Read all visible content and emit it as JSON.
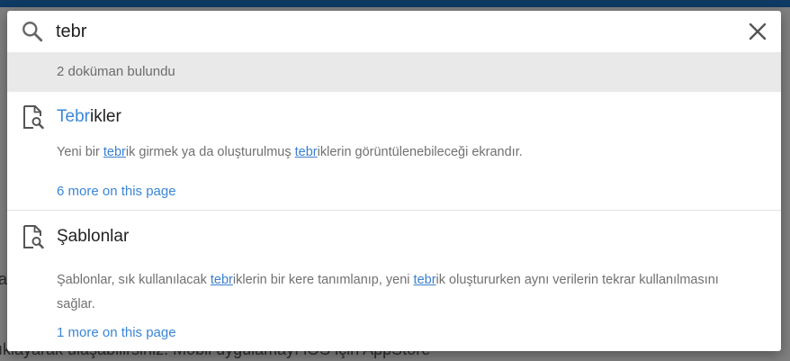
{
  "search": {
    "query": "tebr"
  },
  "results_count": "2 doküman bulundu",
  "results": [
    {
      "title_highlight": "Tebr",
      "title_rest": "ikler",
      "snippet": {
        "p1": "Yeni bir ",
        "h1": "tebr",
        "p2": "ik girmek ya da oluşturulmuş ",
        "h2": "tebr",
        "p3": "iklerin görüntülenebileceği ekrandır."
      },
      "more": "6 more on this page"
    },
    {
      "title": "Şablonlar",
      "snippet": {
        "p1": "Şablonlar, sık kullanılacak ",
        "h1": "tebr",
        "p2": "iklerin bir kere tanımlanıp, yeni ",
        "h2": "tebr",
        "p3": "ik oluştururken aynı verilerin tekrar kullanılmasını sağlar."
      },
      "more": "1 more on this page"
    }
  ],
  "background": {
    "line": "ıklayarak ulaşabilirsiniz. Mobil uygulamayı iOS için AppStore",
    "letter": "a"
  },
  "icons": {
    "search": "search-icon",
    "close": "close-icon",
    "document": "document-search-icon"
  },
  "colors": {
    "accent": "#3a86d8",
    "header_bar": "#0e3a63",
    "count_bar": "#e9e9e9"
  }
}
